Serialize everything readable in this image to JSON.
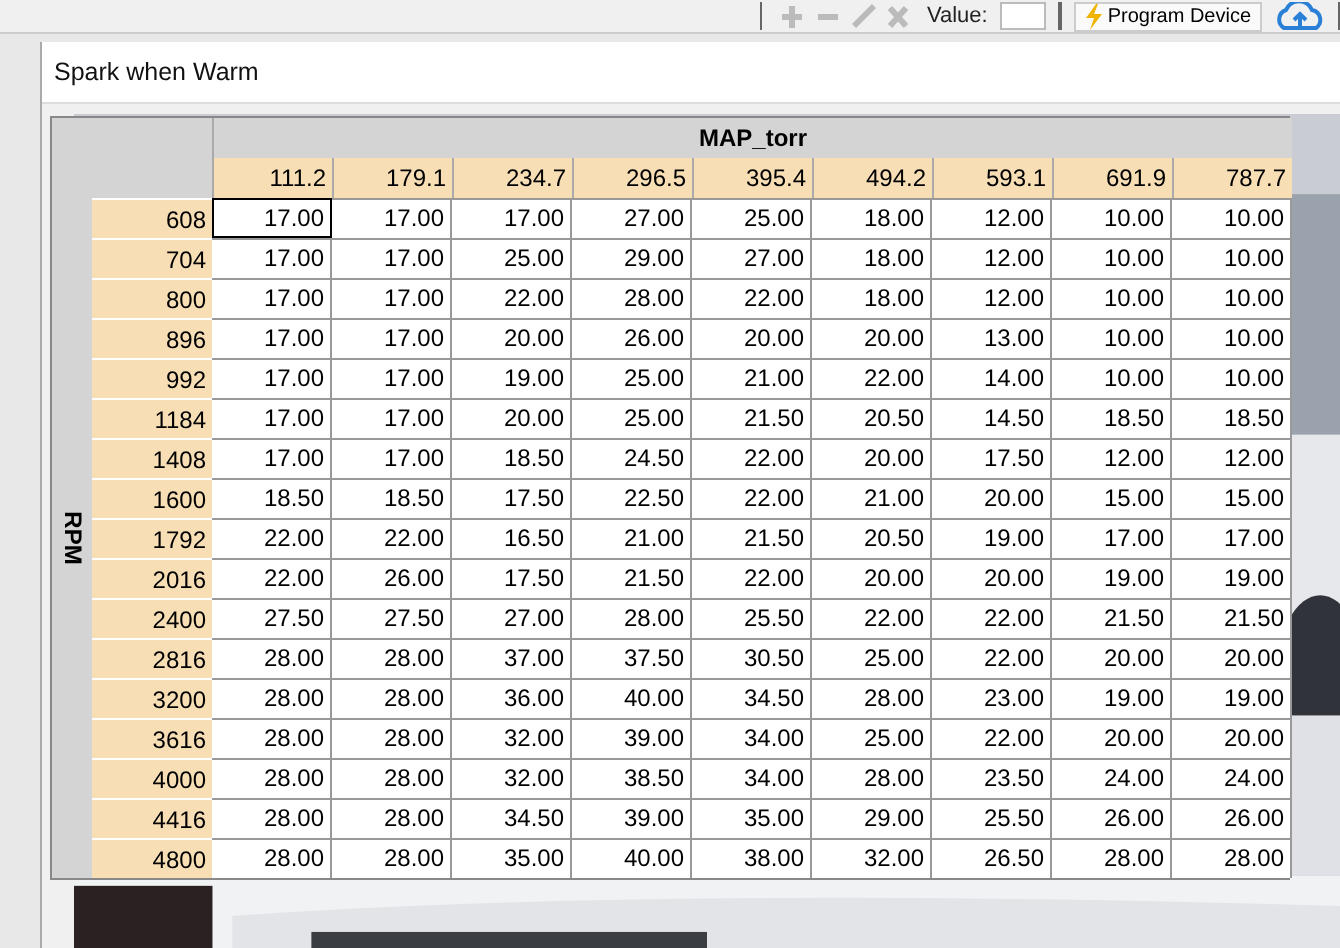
{
  "toolbar": {
    "value_label": "Value:",
    "program_button": "Program Device"
  },
  "window": {
    "title": "Spark when Warm"
  },
  "table": {
    "column_axis": "MAP_torr",
    "row_axis": "RPM",
    "columns": [
      "111.2",
      "179.1",
      "234.7",
      "296.5",
      "395.4",
      "494.2",
      "593.1",
      "691.9",
      "787.7"
    ],
    "rows": [
      {
        "label": "608",
        "cells": [
          {
            "value": "17.00",
            "selected": true
          },
          {
            "value": "17.00",
            "selected": false
          },
          {
            "value": "17.00",
            "selected": false
          },
          {
            "value": "27.00",
            "selected": false
          },
          {
            "value": "25.00",
            "selected": false
          },
          {
            "value": "18.00",
            "selected": false
          },
          {
            "value": "12.00",
            "selected": false
          },
          {
            "value": "10.00",
            "selected": false
          },
          {
            "value": "10.00",
            "selected": false
          }
        ]
      },
      {
        "label": "704",
        "cells": [
          {
            "value": "17.00",
            "selected": false
          },
          {
            "value": "17.00",
            "selected": false
          },
          {
            "value": "25.00",
            "selected": false
          },
          {
            "value": "29.00",
            "selected": false
          },
          {
            "value": "27.00",
            "selected": false
          },
          {
            "value": "18.00",
            "selected": false
          },
          {
            "value": "12.00",
            "selected": false
          },
          {
            "value": "10.00",
            "selected": false
          },
          {
            "value": "10.00",
            "selected": false
          }
        ]
      },
      {
        "label": "800",
        "cells": [
          {
            "value": "17.00",
            "selected": false
          },
          {
            "value": "17.00",
            "selected": false
          },
          {
            "value": "22.00",
            "selected": false
          },
          {
            "value": "28.00",
            "selected": false
          },
          {
            "value": "22.00",
            "selected": false
          },
          {
            "value": "18.00",
            "selected": false
          },
          {
            "value": "12.00",
            "selected": false
          },
          {
            "value": "10.00",
            "selected": false
          },
          {
            "value": "10.00",
            "selected": false
          }
        ]
      },
      {
        "label": "896",
        "cells": [
          {
            "value": "17.00",
            "selected": false
          },
          {
            "value": "17.00",
            "selected": false
          },
          {
            "value": "20.00",
            "selected": false
          },
          {
            "value": "26.00",
            "selected": false
          },
          {
            "value": "20.00",
            "selected": false
          },
          {
            "value": "20.00",
            "selected": false
          },
          {
            "value": "13.00",
            "selected": false
          },
          {
            "value": "10.00",
            "selected": false
          },
          {
            "value": "10.00",
            "selected": false
          }
        ]
      },
      {
        "label": "992",
        "cells": [
          {
            "value": "17.00",
            "selected": false
          },
          {
            "value": "17.00",
            "selected": false
          },
          {
            "value": "19.00",
            "selected": false
          },
          {
            "value": "25.00",
            "selected": false
          },
          {
            "value": "21.00",
            "selected": false
          },
          {
            "value": "22.00",
            "selected": false
          },
          {
            "value": "14.00",
            "selected": false
          },
          {
            "value": "10.00",
            "selected": false
          },
          {
            "value": "10.00",
            "selected": false
          }
        ]
      },
      {
        "label": "1184",
        "cells": [
          {
            "value": "17.00",
            "selected": false
          },
          {
            "value": "17.00",
            "selected": false
          },
          {
            "value": "20.00",
            "selected": false
          },
          {
            "value": "25.00",
            "selected": false
          },
          {
            "value": "21.50",
            "selected": false
          },
          {
            "value": "20.50",
            "selected": false
          },
          {
            "value": "14.50",
            "selected": false
          },
          {
            "value": "18.50",
            "selected": false
          },
          {
            "value": "18.50",
            "selected": false
          }
        ]
      },
      {
        "label": "1408",
        "cells": [
          {
            "value": "17.00",
            "selected": false
          },
          {
            "value": "17.00",
            "selected": false
          },
          {
            "value": "18.50",
            "selected": false
          },
          {
            "value": "24.50",
            "selected": false
          },
          {
            "value": "22.00",
            "selected": false
          },
          {
            "value": "20.00",
            "selected": false
          },
          {
            "value": "17.50",
            "selected": false
          },
          {
            "value": "12.00",
            "selected": false
          },
          {
            "value": "12.00",
            "selected": false
          }
        ]
      },
      {
        "label": "1600",
        "cells": [
          {
            "value": "18.50",
            "selected": false
          },
          {
            "value": "18.50",
            "selected": false
          },
          {
            "value": "17.50",
            "selected": false
          },
          {
            "value": "22.50",
            "selected": false
          },
          {
            "value": "22.00",
            "selected": false
          },
          {
            "value": "21.00",
            "selected": false
          },
          {
            "value": "20.00",
            "selected": false
          },
          {
            "value": "15.00",
            "selected": false
          },
          {
            "value": "15.00",
            "selected": false
          }
        ]
      },
      {
        "label": "1792",
        "cells": [
          {
            "value": "22.00",
            "selected": false
          },
          {
            "value": "22.00",
            "selected": false
          },
          {
            "value": "16.50",
            "selected": false
          },
          {
            "value": "21.00",
            "selected": false
          },
          {
            "value": "21.50",
            "selected": false
          },
          {
            "value": "20.50",
            "selected": false
          },
          {
            "value": "19.00",
            "selected": false
          },
          {
            "value": "17.00",
            "selected": false
          },
          {
            "value": "17.00",
            "selected": false
          }
        ]
      },
      {
        "label": "2016",
        "cells": [
          {
            "value": "22.00",
            "selected": false
          },
          {
            "value": "26.00",
            "selected": false
          },
          {
            "value": "17.50",
            "selected": false
          },
          {
            "value": "21.50",
            "selected": false
          },
          {
            "value": "22.00",
            "selected": false
          },
          {
            "value": "20.00",
            "selected": false
          },
          {
            "value": "20.00",
            "selected": false
          },
          {
            "value": "19.00",
            "selected": false
          },
          {
            "value": "19.00",
            "selected": false
          }
        ]
      },
      {
        "label": "2400",
        "cells": [
          {
            "value": "27.50",
            "selected": false
          },
          {
            "value": "27.50",
            "selected": false
          },
          {
            "value": "27.00",
            "selected": false
          },
          {
            "value": "28.00",
            "selected": false
          },
          {
            "value": "25.50",
            "selected": false
          },
          {
            "value": "22.00",
            "selected": false
          },
          {
            "value": "22.00",
            "selected": false
          },
          {
            "value": "21.50",
            "selected": false
          },
          {
            "value": "21.50",
            "selected": false
          }
        ]
      },
      {
        "label": "2816",
        "cells": [
          {
            "value": "28.00",
            "selected": false
          },
          {
            "value": "28.00",
            "selected": false
          },
          {
            "value": "37.00",
            "selected": false
          },
          {
            "value": "37.50",
            "selected": false
          },
          {
            "value": "30.50",
            "selected": false
          },
          {
            "value": "25.00",
            "selected": false
          },
          {
            "value": "22.00",
            "selected": false
          },
          {
            "value": "20.00",
            "selected": false
          },
          {
            "value": "20.00",
            "selected": false
          }
        ]
      },
      {
        "label": "3200",
        "cells": [
          {
            "value": "28.00",
            "selected": false
          },
          {
            "value": "28.00",
            "selected": false
          },
          {
            "value": "36.00",
            "selected": false
          },
          {
            "value": "40.00",
            "selected": false
          },
          {
            "value": "34.50",
            "selected": false
          },
          {
            "value": "28.00",
            "selected": false
          },
          {
            "value": "23.00",
            "selected": false
          },
          {
            "value": "19.00",
            "selected": false
          },
          {
            "value": "19.00",
            "selected": false
          }
        ]
      },
      {
        "label": "3616",
        "cells": [
          {
            "value": "28.00",
            "selected": false
          },
          {
            "value": "28.00",
            "selected": false
          },
          {
            "value": "32.00",
            "selected": false
          },
          {
            "value": "39.00",
            "selected": false
          },
          {
            "value": "34.00",
            "selected": false
          },
          {
            "value": "25.00",
            "selected": false
          },
          {
            "value": "22.00",
            "selected": false
          },
          {
            "value": "20.00",
            "selected": false
          },
          {
            "value": "20.00",
            "selected": false
          }
        ]
      },
      {
        "label": "4000",
        "cells": [
          {
            "value": "28.00",
            "selected": false
          },
          {
            "value": "28.00",
            "selected": false
          },
          {
            "value": "32.00",
            "selected": false
          },
          {
            "value": "38.50",
            "selected": false
          },
          {
            "value": "34.00",
            "selected": false
          },
          {
            "value": "28.00",
            "selected": false
          },
          {
            "value": "23.50",
            "selected": false
          },
          {
            "value": "24.00",
            "selected": false
          },
          {
            "value": "24.00",
            "selected": false
          }
        ]
      },
      {
        "label": "4416",
        "cells": [
          {
            "value": "28.00",
            "selected": false
          },
          {
            "value": "28.00",
            "selected": false
          },
          {
            "value": "34.50",
            "selected": false
          },
          {
            "value": "39.00",
            "selected": false
          },
          {
            "value": "35.00",
            "selected": false
          },
          {
            "value": "29.00",
            "selected": false
          },
          {
            "value": "25.50",
            "selected": false
          },
          {
            "value": "26.00",
            "selected": false
          },
          {
            "value": "26.00",
            "selected": false
          }
        ]
      },
      {
        "label": "4800",
        "cells": [
          {
            "value": "28.00",
            "selected": false
          },
          {
            "value": "28.00",
            "selected": false
          },
          {
            "value": "35.00",
            "selected": false
          },
          {
            "value": "40.00",
            "selected": false
          },
          {
            "value": "38.00",
            "selected": false
          },
          {
            "value": "32.00",
            "selected": false
          },
          {
            "value": "26.50",
            "selected": false
          },
          {
            "value": "28.00",
            "selected": false
          },
          {
            "value": "28.00",
            "selected": false
          }
        ]
      }
    ]
  }
}
